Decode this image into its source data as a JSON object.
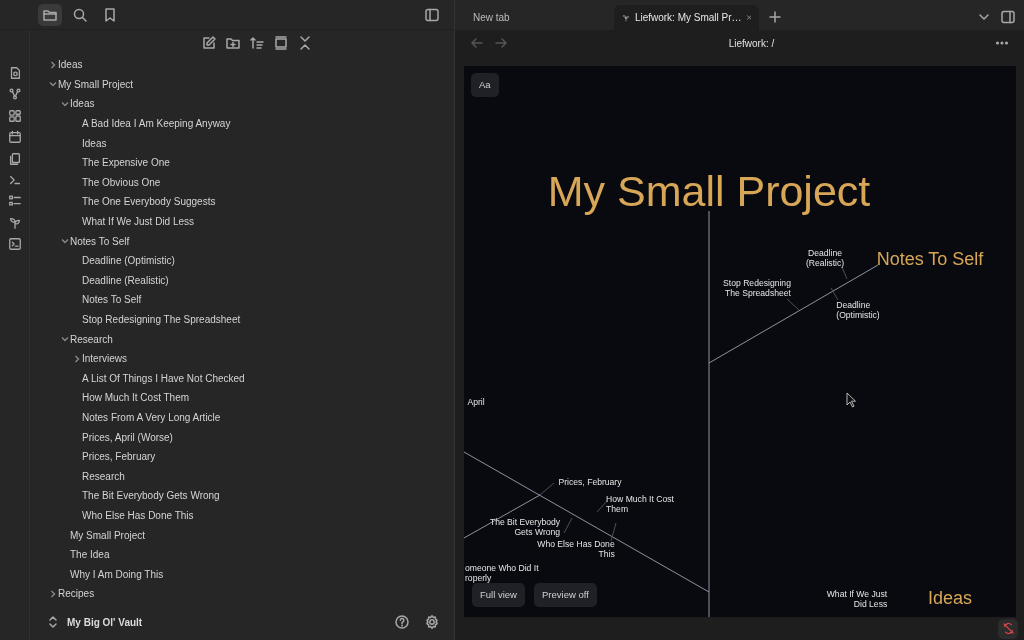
{
  "sidebar_tabs": [
    {
      "selected": true
    },
    {
      "selected": false
    },
    {
      "selected": false
    }
  ],
  "tabs": [
    {
      "label": "New tab",
      "selected": false
    },
    {
      "label": "Liefwork: My Small Pr…",
      "selected": true
    }
  ],
  "view_title": "Liefwork: /",
  "tree": [
    {
      "kind": "folder",
      "label": "Ideas",
      "expanded": false
    },
    {
      "kind": "folder",
      "label": "My Small Project",
      "expanded": true,
      "children": [
        {
          "kind": "folder",
          "label": "Ideas",
          "expanded": true,
          "children": [
            {
              "kind": "file",
              "label": "A Bad Idea I Am Keeping Anyway"
            },
            {
              "kind": "file",
              "label": "Ideas"
            },
            {
              "kind": "file",
              "label": "The Expensive One"
            },
            {
              "kind": "file",
              "label": "The Obvious One"
            },
            {
              "kind": "file",
              "label": "The One Everybody Suggests"
            },
            {
              "kind": "file",
              "label": "What If We Just Did Less"
            }
          ]
        },
        {
          "kind": "folder",
          "label": "Notes To Self",
          "expanded": true,
          "children": [
            {
              "kind": "file",
              "label": "Deadline (Optimistic)"
            },
            {
              "kind": "file",
              "label": "Deadline (Realistic)"
            },
            {
              "kind": "file",
              "label": "Notes To Self"
            },
            {
              "kind": "file",
              "label": "Stop Redesigning The Spreadsheet"
            }
          ]
        },
        {
          "kind": "folder",
          "label": "Research",
          "expanded": true,
          "children": [
            {
              "kind": "folder",
              "label": "Interviews",
              "expanded": false
            },
            {
              "kind": "file",
              "label": "A List Of Things I Have Not Checked"
            },
            {
              "kind": "file",
              "label": "How Much It Cost Them"
            },
            {
              "kind": "file",
              "label": "Notes From A Very Long Article"
            },
            {
              "kind": "file",
              "label": "Prices, April (Worse)"
            },
            {
              "kind": "file",
              "label": "Prices, February"
            },
            {
              "kind": "file",
              "label": "Research"
            },
            {
              "kind": "file",
              "label": "The Bit Everybody Gets Wrong"
            },
            {
              "kind": "file",
              "label": "Who Else Has Done This"
            }
          ]
        },
        {
          "kind": "file",
          "label": "My Small Project"
        },
        {
          "kind": "file",
          "label": "The Idea"
        },
        {
          "kind": "file",
          "label": "Why I Am Doing This"
        }
      ]
    },
    {
      "kind": "folder",
      "label": "Recipes",
      "expanded": false
    }
  ],
  "vault": "My Big Ol' Vault",
  "canvas": {
    "font_button": "Aa",
    "nodes": [
      {
        "kind": "root",
        "text": "My Small Project"
      },
      {
        "kind": "branch",
        "text": "Notes To Self"
      },
      {
        "kind": "leaf",
        "text": "Deadline\n(Realistic)"
      },
      {
        "kind": "leaf",
        "text": "Stop Redesigning\nThe Spreadsheet"
      },
      {
        "kind": "leaf",
        "text": "Deadline\n(Optimistic)"
      },
      {
        "kind": "leaf",
        "text": "April"
      },
      {
        "kind": "leaf",
        "text": "Prices, February"
      },
      {
        "kind": "leaf",
        "text": "How Much It Cost\nThem"
      },
      {
        "kind": "leaf",
        "text": "The Bit Everybody\nGets Wrong"
      },
      {
        "kind": "leaf",
        "text": "Who Else Has Done\nThis"
      },
      {
        "kind": "leaf",
        "text": "omeone Who Did It\nroperly"
      },
      {
        "kind": "leaf",
        "text": "What If We Just\nDid Less"
      },
      {
        "kind": "branch",
        "text": "Ideas"
      }
    ],
    "buttons": [
      "Full view",
      "Preview off"
    ]
  }
}
